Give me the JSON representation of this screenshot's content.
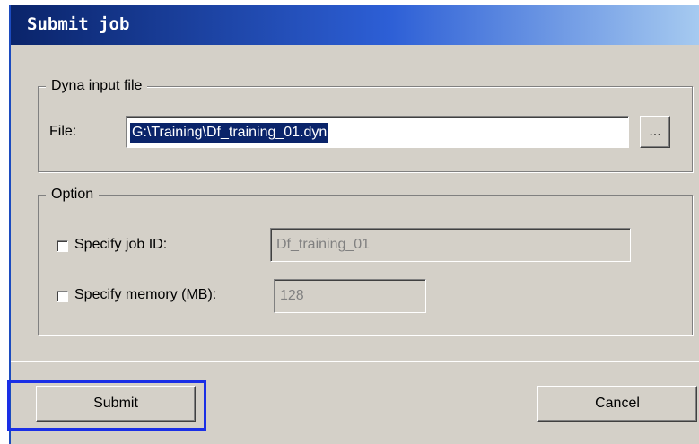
{
  "window": {
    "title": "Submit job"
  },
  "dyna_group": {
    "legend": "Dyna input file",
    "file_label": "File:",
    "file_value": "G:\\Training\\Df_training_01.dyn",
    "browse_label": "..."
  },
  "option_group": {
    "legend": "Option",
    "job_id": {
      "label": "Specify job ID:",
      "checked": false,
      "value": "Df_training_01"
    },
    "memory": {
      "label": "Specify memory (MB):",
      "checked": false,
      "value": "128"
    }
  },
  "buttons": {
    "submit": "Submit",
    "cancel": "Cancel"
  },
  "colors": {
    "highlight": "#1a2fe6",
    "selection": "#0a246a"
  }
}
